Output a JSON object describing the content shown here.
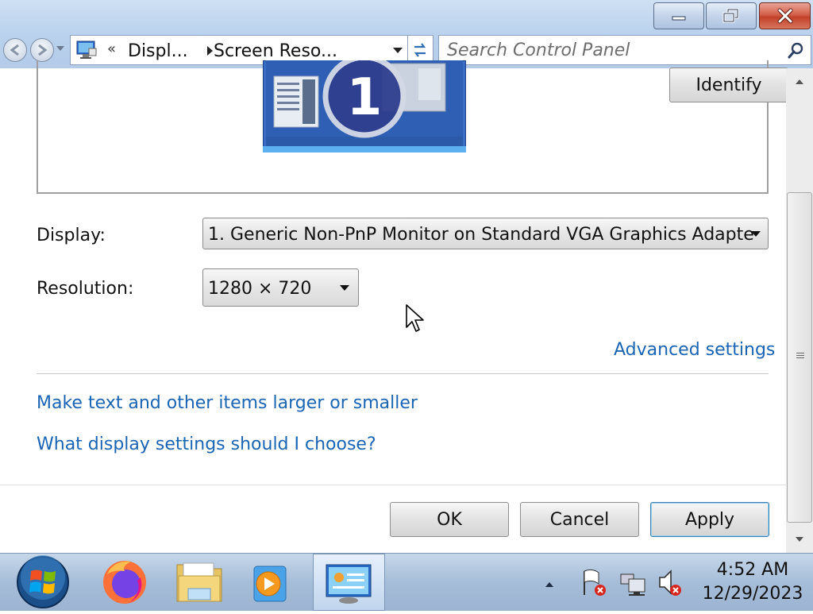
{
  "window": {
    "caption_buttons": {
      "minimize": "minimize-icon",
      "maximize": "restore-icon",
      "close": "close-icon"
    }
  },
  "navigation": {
    "address": {
      "chevron": "«",
      "crumbs": [
        "Displ...",
        "Screen Reso..."
      ]
    },
    "search": {
      "placeholder": "Search Control Panel"
    }
  },
  "preview": {
    "monitor_number": "1",
    "identify_label": "Identify"
  },
  "form": {
    "display_label": "Display:",
    "display_value": "1. Generic Non-PnP Monitor on Standard VGA Graphics Adapte",
    "resolution_label": "Resolution:",
    "resolution_value": "1280 × 720",
    "advanced_link": "Advanced settings"
  },
  "links": {
    "text_size": "Make text and other items larger or smaller",
    "help": "What display settings should I choose?"
  },
  "buttons": {
    "ok": "OK",
    "cancel": "Cancel",
    "apply": "Apply"
  },
  "taskbar": {
    "items": [
      "start-orb-icon",
      "firefox-icon",
      "file-explorer-icon",
      "media-player-icon",
      "control-panel-icon"
    ],
    "tray": [
      "show-hidden-icons",
      "action-center-flag-icon",
      "network-icon",
      "volume-muted-icon"
    ],
    "time": "4:52 AM",
    "date": "12/29/2023"
  },
  "colors": {
    "link": "#1a64b4",
    "close_button": "#c1412a",
    "taskbar": "#a6bdd8"
  }
}
